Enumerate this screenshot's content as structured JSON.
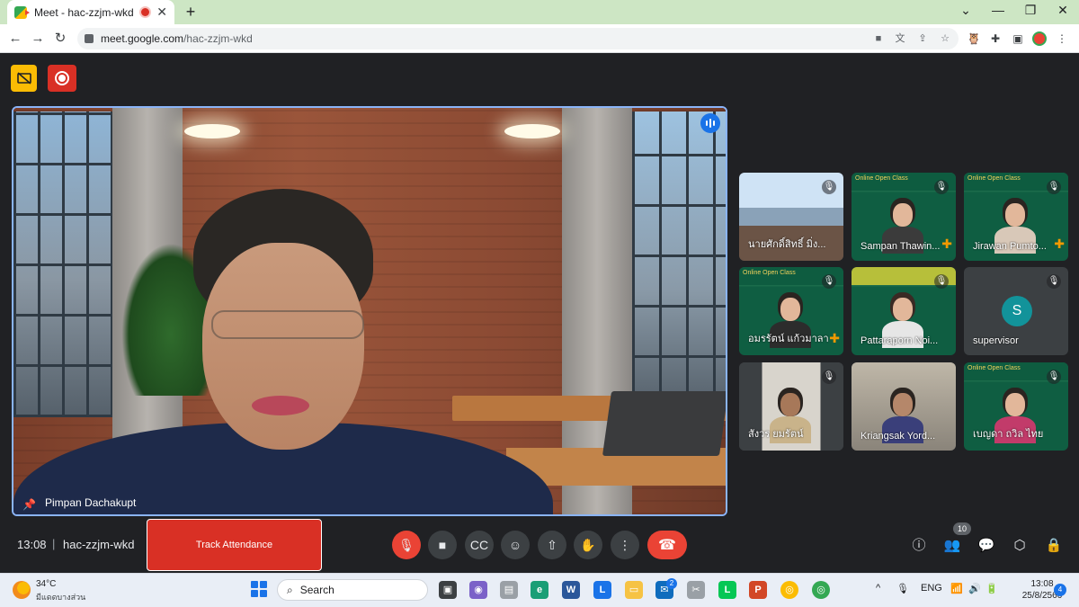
{
  "browser": {
    "tab_title": "Meet - hac-zzjm-wkd",
    "new_tab": "+",
    "url_host": "meet.google.com",
    "url_path": "/hac-zzjm-wkd"
  },
  "meet": {
    "main_speaker": "Pimpan Dachakupt",
    "clock": "13:08",
    "separator": "|",
    "meeting_code": "hac-zzjm-wkd",
    "track_attendance_label": "Track Attendance",
    "participant_count": "10",
    "tiles": [
      {
        "name": "นายศักดิ์สิทธิ์ มิ่ง...",
        "muted": true
      },
      {
        "name": "Sampan Thawin...",
        "muted": true
      },
      {
        "name": "Jirawan Pumto...",
        "muted": true
      },
      {
        "name": "อมรรัตน์ แก้วมาลา",
        "muted": true
      },
      {
        "name": "Pattaraporn Noi...",
        "muted": true
      },
      {
        "name": "supervisor",
        "muted": true,
        "avatar_letter": "S"
      },
      {
        "name": "สังวร ยมรัตน์",
        "muted": true
      },
      {
        "name": "Kriangsak Yord...",
        "muted": false
      },
      {
        "name": "เบญดา ถวิล ไทย",
        "muted": true
      }
    ],
    "banner_text": "Online Open Class"
  },
  "taskbar": {
    "weather_temp": "34°C",
    "weather_desc": "มีแดดบางส่วน",
    "search_placeholder": "Search",
    "lang": "ENG",
    "time": "13:08",
    "date": "25/8/2566",
    "notification_count": "4",
    "mail_badge": "2"
  },
  "colors": {
    "meet_bg": "#202124",
    "accent_blue": "#8ab4f8",
    "danger_red": "#ea4335",
    "record_red": "#d93025",
    "captions_yellow": "#fbbc04"
  }
}
